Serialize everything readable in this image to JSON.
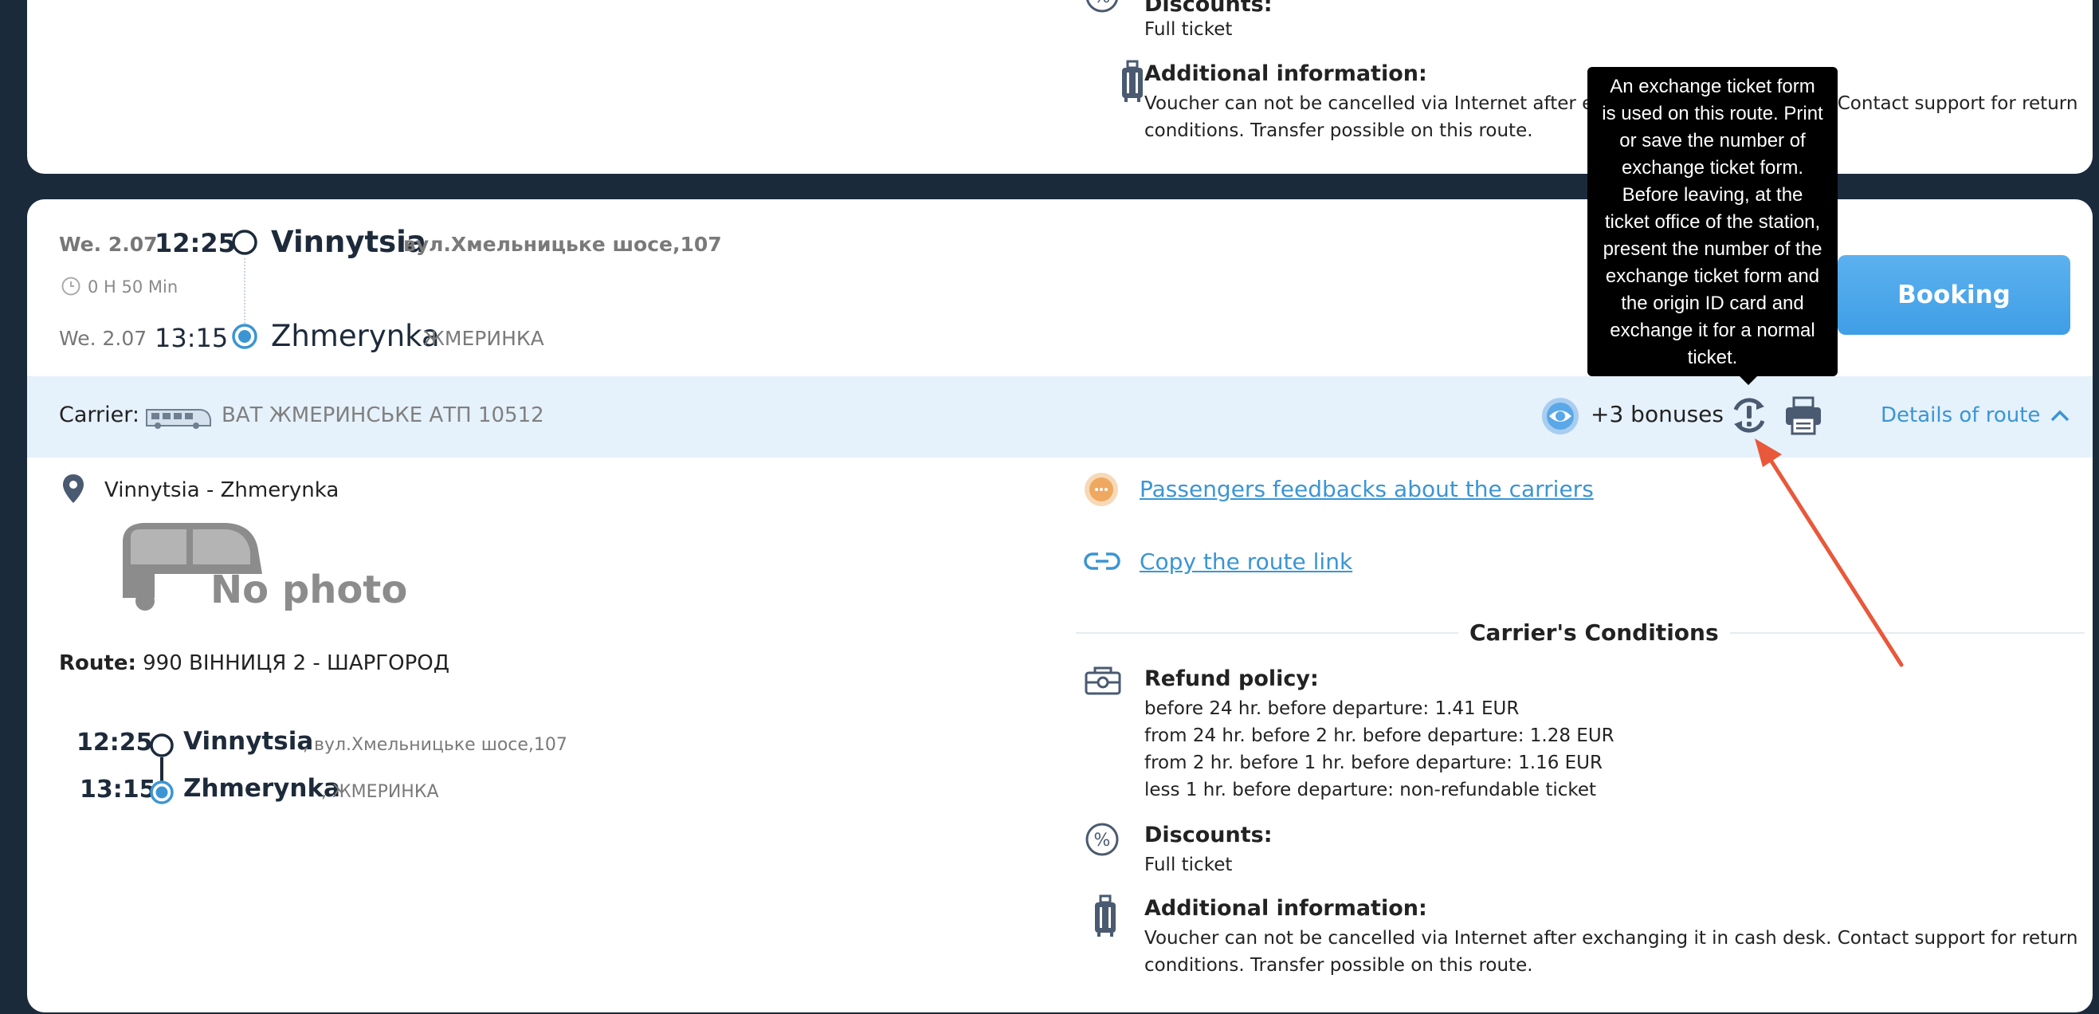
{
  "prev_card": {
    "discounts_label": "Discounts:",
    "discounts_value": "Full ticket",
    "additional_label": "Additional information:",
    "additional_line1": "Voucher can not be cancelled via Internet after exchanging it in cash desk. Contact support for return",
    "additional_line2": "conditions. Transfer possible on this route."
  },
  "trip": {
    "dep_date": "We. 2.07",
    "dep_time": "12:25",
    "dep_city": "Vinnytsia",
    "dep_address": "вул.Хмельницьке шосе,107",
    "duration": "0 H 50 Min",
    "arr_date": "We. 2.07",
    "arr_time": "13:15",
    "arr_city": "Zhmerynka",
    "arr_address": "ЖМЕРИНКА",
    "booking_label": "Booking"
  },
  "carrier_bar": {
    "label": "Carrier:",
    "name": "ВАТ ЖМЕРИНСЬКЕ АТП 10512",
    "bonuses": "+3 bonuses",
    "details_label": "Details of route"
  },
  "tooltip": {
    "lines": [
      "An exchange ticket form",
      "is used on this route. Print",
      "or save the number of",
      "exchange ticket form.",
      "Before leaving, at the",
      "ticket office of the station,",
      "present the number of the",
      "exchange ticket form and",
      "the origin ID card and",
      "exchange it for a normal",
      "ticket."
    ]
  },
  "details": {
    "route_name": "Vinnytsia - Zhmerynka",
    "no_photo": "No photo",
    "route_label": "Route:",
    "route_value": "990 ВІННИЦЯ 2 - ШАРГОРОД",
    "stops": [
      {
        "time": "12:25",
        "city": "Vinnytsia",
        "address": ", вул.Хмельницьке шосе,107"
      },
      {
        "time": "13:15",
        "city": "Zhmerynka",
        "address": ", ЖМЕРИНКА"
      }
    ],
    "feedback_link": "Passengers feedbacks about the carriers",
    "copy_link": "Copy the route link",
    "conditions_title": "Carrier's Conditions",
    "refund_label": "Refund policy:",
    "refund_lines": [
      "before 24 hr. before departure: 1.41 EUR",
      "from 24 hr. before 2 hr. before departure: 1.28 EUR",
      "from 2 hr. before 1 hr. before departure: 1.16 EUR",
      "less 1 hr. before departure: non-refundable ticket"
    ],
    "discounts_label": "Discounts:",
    "discounts_value": "Full ticket",
    "additional_label": "Additional information:",
    "additional_line1": "Voucher can not be cancelled via Internet after exchanging it in cash desk. Contact support for return",
    "additional_line2": "conditions. Transfer possible on this route."
  },
  "colors": {
    "accent": "#3b95d3",
    "booking": "#4aa6ea",
    "annotation_arrow": "#e8583a",
    "carrier_bar_bg": "#e5f1fb",
    "page_bg": "#1b2a3b"
  }
}
